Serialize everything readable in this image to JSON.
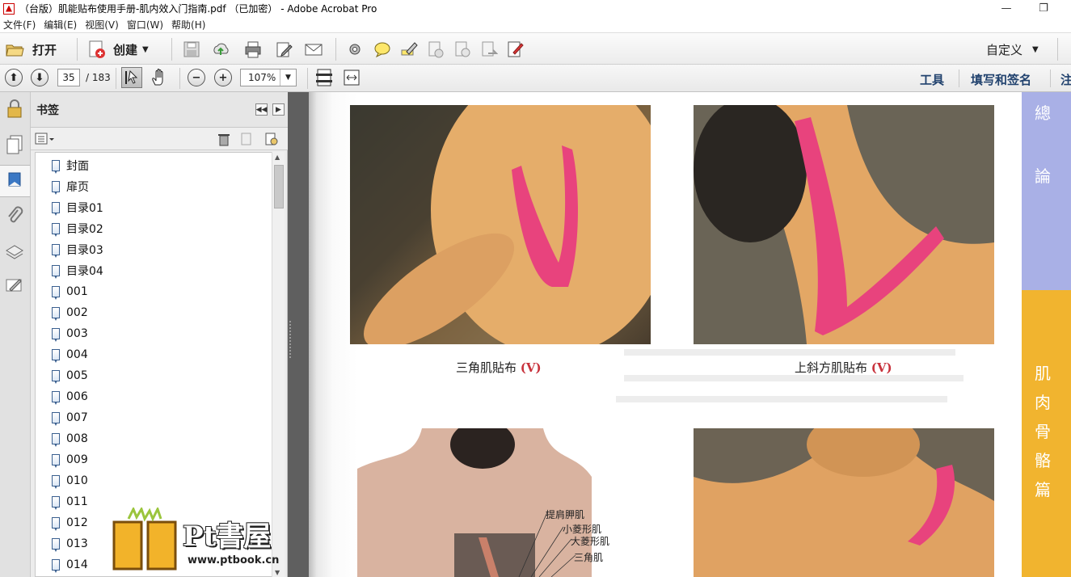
{
  "window": {
    "title": "（台版）肌能贴布使用手册-肌内效入门指南.pdf （已加密） - Adobe Acrobat Pro",
    "minimize": "—",
    "restore": "❐"
  },
  "menu": [
    "文件(F)",
    "编辑(E)",
    "视图(V)",
    "窗口(W)",
    "帮助(H)"
  ],
  "toolbar": {
    "open_label": "打开",
    "create_label": "创建",
    "customize_label": "自定义"
  },
  "nav": {
    "current_page": "35",
    "total_pages": "/ 183",
    "zoom": "107%",
    "tools_link": "工具",
    "sign_link": "填写和签名",
    "comment_link": "注"
  },
  "bookmarks": {
    "title": "书签",
    "items": [
      "封面",
      "扉页",
      "目录01",
      "目录02",
      "目录03",
      "目录04",
      "001",
      "002",
      "003",
      "004",
      "005",
      "006",
      "007",
      "008",
      "009",
      "010",
      "011",
      "012",
      "013",
      "014"
    ]
  },
  "document": {
    "caption_left": "三角肌貼布",
    "caption_left_mark": "(V)",
    "caption_right": "上斜方肌貼布",
    "caption_right_mark": "(V)",
    "side_top": [
      "總",
      "論"
    ],
    "side_bottom": [
      "肌",
      "肉",
      "骨",
      "骼",
      "篇"
    ],
    "anatomy_labels": [
      "提肩胛肌",
      "小菱形肌",
      "大菱形肌",
      "三角肌"
    ],
    "colors": {
      "tape": "#e8437d",
      "side_top": "#a9b0e6",
      "side_bottom": "#f1b42f"
    }
  },
  "watermark": {
    "brand": "Pt書屋",
    "url": "www.ptbook.cn"
  }
}
